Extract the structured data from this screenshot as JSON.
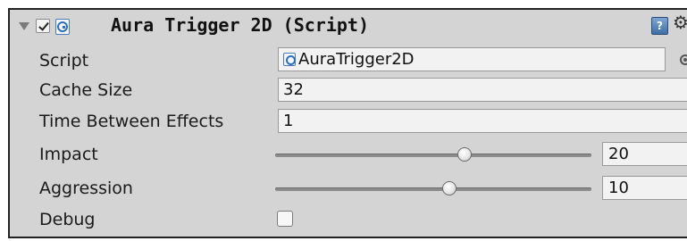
{
  "component": {
    "title": "Aura Trigger 2D (Script)",
    "enabled": true,
    "icons": [
      "foldout-arrow-icon",
      "script-icon",
      "help-icon",
      "gear-icon"
    ]
  },
  "fields": {
    "script": {
      "label": "Script",
      "value": "AuraTrigger2D"
    },
    "cache_size": {
      "label": "Cache Size",
      "value": "32"
    },
    "time_between_effects": {
      "label": "Time Between Effects",
      "value": "1"
    },
    "impact": {
      "label": "Impact",
      "value": "20",
      "slider_fraction": 0.6
    },
    "aggression": {
      "label": "Aggression",
      "value": "10",
      "slider_fraction": 0.55
    },
    "debug": {
      "label": "Debug",
      "checked": false
    }
  },
  "help_glyph": "?",
  "gear_glyph": "⚙"
}
